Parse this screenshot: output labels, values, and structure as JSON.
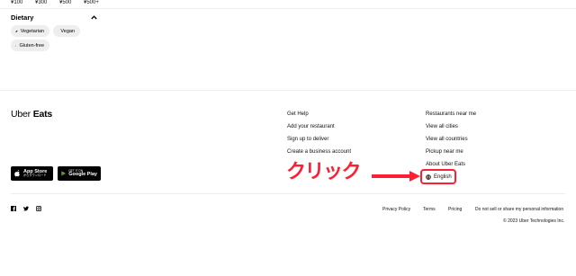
{
  "price_filters": [
    "¥100",
    "¥300",
    "¥500",
    "¥500+"
  ],
  "dietary": {
    "title": "Dietary",
    "chips": [
      {
        "label": "Vegetarian",
        "icon": "leaf-icon"
      },
      {
        "label": "Vegan",
        "icon": "heart-icon"
      },
      {
        "label": "Gluten-free",
        "icon": "wheat-off-icon"
      }
    ]
  },
  "footer": {
    "logo_main": "Uber",
    "logo_sub": "Eats",
    "app_store": {
      "small": "App Store",
      "big": "からダウンロード"
    },
    "google_play": {
      "small": "GET IT ON",
      "big": "Google Play"
    },
    "col_a": [
      "Get Help",
      "Add your restaurant",
      "Sign up to deliver",
      "Create a business account"
    ],
    "col_b": [
      "Restaurants near me",
      "View all cities",
      "View all countries",
      "Pickup near me",
      "About Uber Eats"
    ],
    "language": "English",
    "social_icons": [
      "facebook-icon",
      "twitter-icon",
      "instagram-icon"
    ],
    "legal": {
      "privacy": "Privacy Policy",
      "terms": "Terms",
      "pricing": "Pricing",
      "do_not_sell": "Do not sell or share my personal information"
    },
    "copyright": "© 2023 Uber Technologies Inc."
  },
  "annotation": {
    "text": "クリック",
    "color": "#ff1f33"
  }
}
